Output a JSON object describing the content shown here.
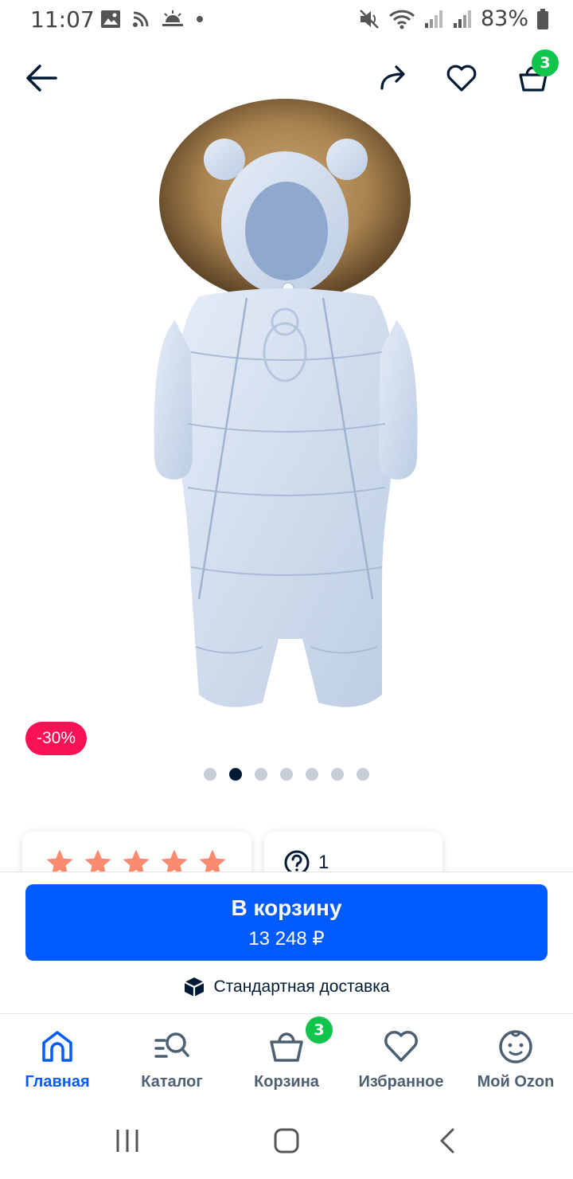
{
  "status_bar": {
    "time": "11:07",
    "battery": "83%"
  },
  "top_bar": {
    "cart_count": "3"
  },
  "product": {
    "discount": "-30%",
    "gallery_total": 7,
    "gallery_active": 2,
    "rating_stars": 5,
    "questions_count": "1"
  },
  "buy": {
    "button_label": "В корзину",
    "price": "13 248 ₽",
    "delivery": "Стандартная доставка"
  },
  "nav": {
    "items": [
      {
        "label": "Главная",
        "icon": "home-icon",
        "active": true
      },
      {
        "label": "Каталог",
        "icon": "catalog-search-icon",
        "active": false
      },
      {
        "label": "Корзина",
        "icon": "basket-icon",
        "active": false
      },
      {
        "label": "Избранное",
        "icon": "heart-icon",
        "active": false
      },
      {
        "label": "Мой Ozon",
        "icon": "profile-face-icon",
        "active": false
      }
    ],
    "cart_badge": "3"
  },
  "colors": {
    "primary": "#005bff",
    "discount": "#f91155",
    "badge": "#10c44c",
    "star": "#f88b6e"
  }
}
